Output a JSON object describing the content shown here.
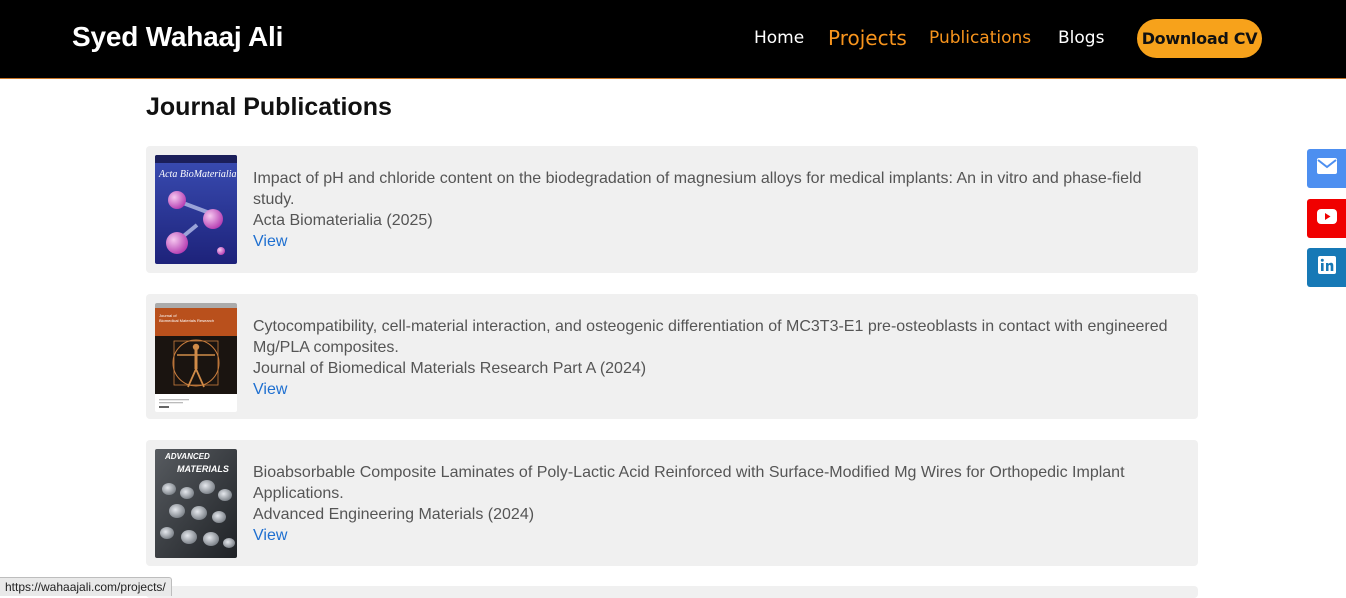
{
  "header": {
    "brand": "Syed Wahaaj Ali",
    "nav": {
      "home": "Home",
      "projects": "Projects",
      "publications": "Publications",
      "blogs": "Blogs"
    },
    "cta": "Download CV",
    "colors": {
      "accent": "#f7941d",
      "background": "#000000"
    }
  },
  "main": {
    "section_title": "Journal Publications",
    "publications": [
      {
        "title": "Impact of pH and chloride content on the biodegradation of magnesium alloys for medical implants: An in vitro and phase-field study.",
        "journal": "Acta Biomaterialia (2025)",
        "link_label": "View",
        "cover": {
          "name": "Acta BioMateralia",
          "icon": "journal-cover-icon"
        }
      },
      {
        "title": "Cytocompatibility, cell-material interaction, and osteogenic differentiation of MC3T3-E1 pre-osteoblasts in contact with engineered Mg/PLA composites.",
        "journal": "Journal of Biomedical Materials Research Part A (2024)",
        "link_label": "View",
        "cover": {
          "name": "Journal of Biomedical Materials Research",
          "icon": "journal-cover-icon"
        }
      },
      {
        "title": "Bioabsorbable Composite Laminates of Poly-Lactic Acid Reinforced with Surface-Modified Mg Wires for Orthopedic Implant Applications.",
        "journal": "Advanced Engineering Materials (2024)",
        "link_label": "View",
        "cover": {
          "name": "ADVANCED MATERIALS",
          "icon": "journal-cover-icon"
        }
      }
    ]
  },
  "social": [
    {
      "name": "mail-icon",
      "color": "#4d8ff0"
    },
    {
      "name": "youtube-icon",
      "color": "#f00000"
    },
    {
      "name": "linkedin-icon",
      "color": "#1779b6"
    }
  ],
  "status_bar": "https://wahaajali.com/projects/"
}
